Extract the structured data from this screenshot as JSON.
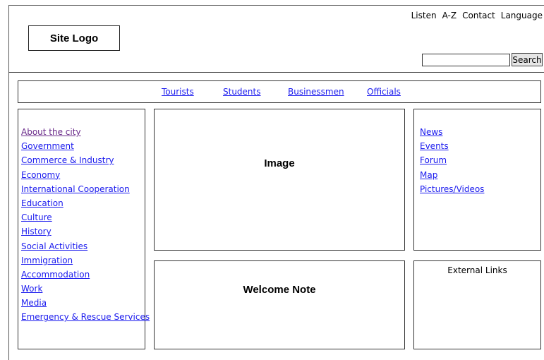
{
  "header": {
    "logo_text": "Site Logo",
    "utility_links": [
      "Listen",
      "A-Z",
      "Contact",
      "Language"
    ],
    "search": {
      "value": "",
      "placeholder": "",
      "button_label": "Search"
    }
  },
  "audience_nav": [
    "Tourists",
    "Students",
    "Businessmen",
    "Officials"
  ],
  "left_menu": [
    "About the city",
    "Government",
    "Commerce & Industry",
    "Economy",
    "International Cooperation",
    "Education",
    "Culture",
    "History",
    "Social Activities",
    "Immigration",
    "Accommodation",
    "Work",
    "Media",
    "Emergency & Rescue Services"
  ],
  "main": {
    "image_label": "Image",
    "welcome_label": "Welcome Note"
  },
  "right_menu": [
    "News",
    "Events",
    "Forum",
    "Map",
    "Pictures/Videos"
  ],
  "external_links": {
    "title": "External Links"
  },
  "colors": {
    "link": "#1a1aee",
    "visited_link": "#6a2a8a",
    "border": "#333333"
  }
}
